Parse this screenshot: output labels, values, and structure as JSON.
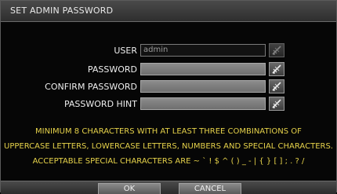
{
  "dialog": {
    "title": "SET ADMIN PASSWORD"
  },
  "form": {
    "user": {
      "label": "USER",
      "value": "admin"
    },
    "password": {
      "label": "PASSWORD",
      "value": ""
    },
    "confirm_password": {
      "label": "CONFIRM PASSWORD",
      "value": ""
    },
    "password_hint": {
      "label": "PASSWORD HINT",
      "value": ""
    }
  },
  "info": {
    "line1": "MINIMUM 8 CHARACTERS WITH AT LEAST THREE COMBINATIONS OF",
    "line2": "UPPERCASE LETTERS, LOWERCASE LETTERS, NUMBERS AND SPECIAL CHARACTERS.",
    "line3": "ACCEPTABLE SPECIAL CHARACTERS ARE ~ ` ! $ ^ ( ) _ - | { } [ ] ; . ? /"
  },
  "buttons": {
    "ok": "OK",
    "cancel": "CANCEL"
  },
  "colors": {
    "info_text": "#e6d24a",
    "title_bar": "#3c3c3c"
  },
  "icons": {
    "keyboard_button": "virtual-keyboard-icon"
  }
}
